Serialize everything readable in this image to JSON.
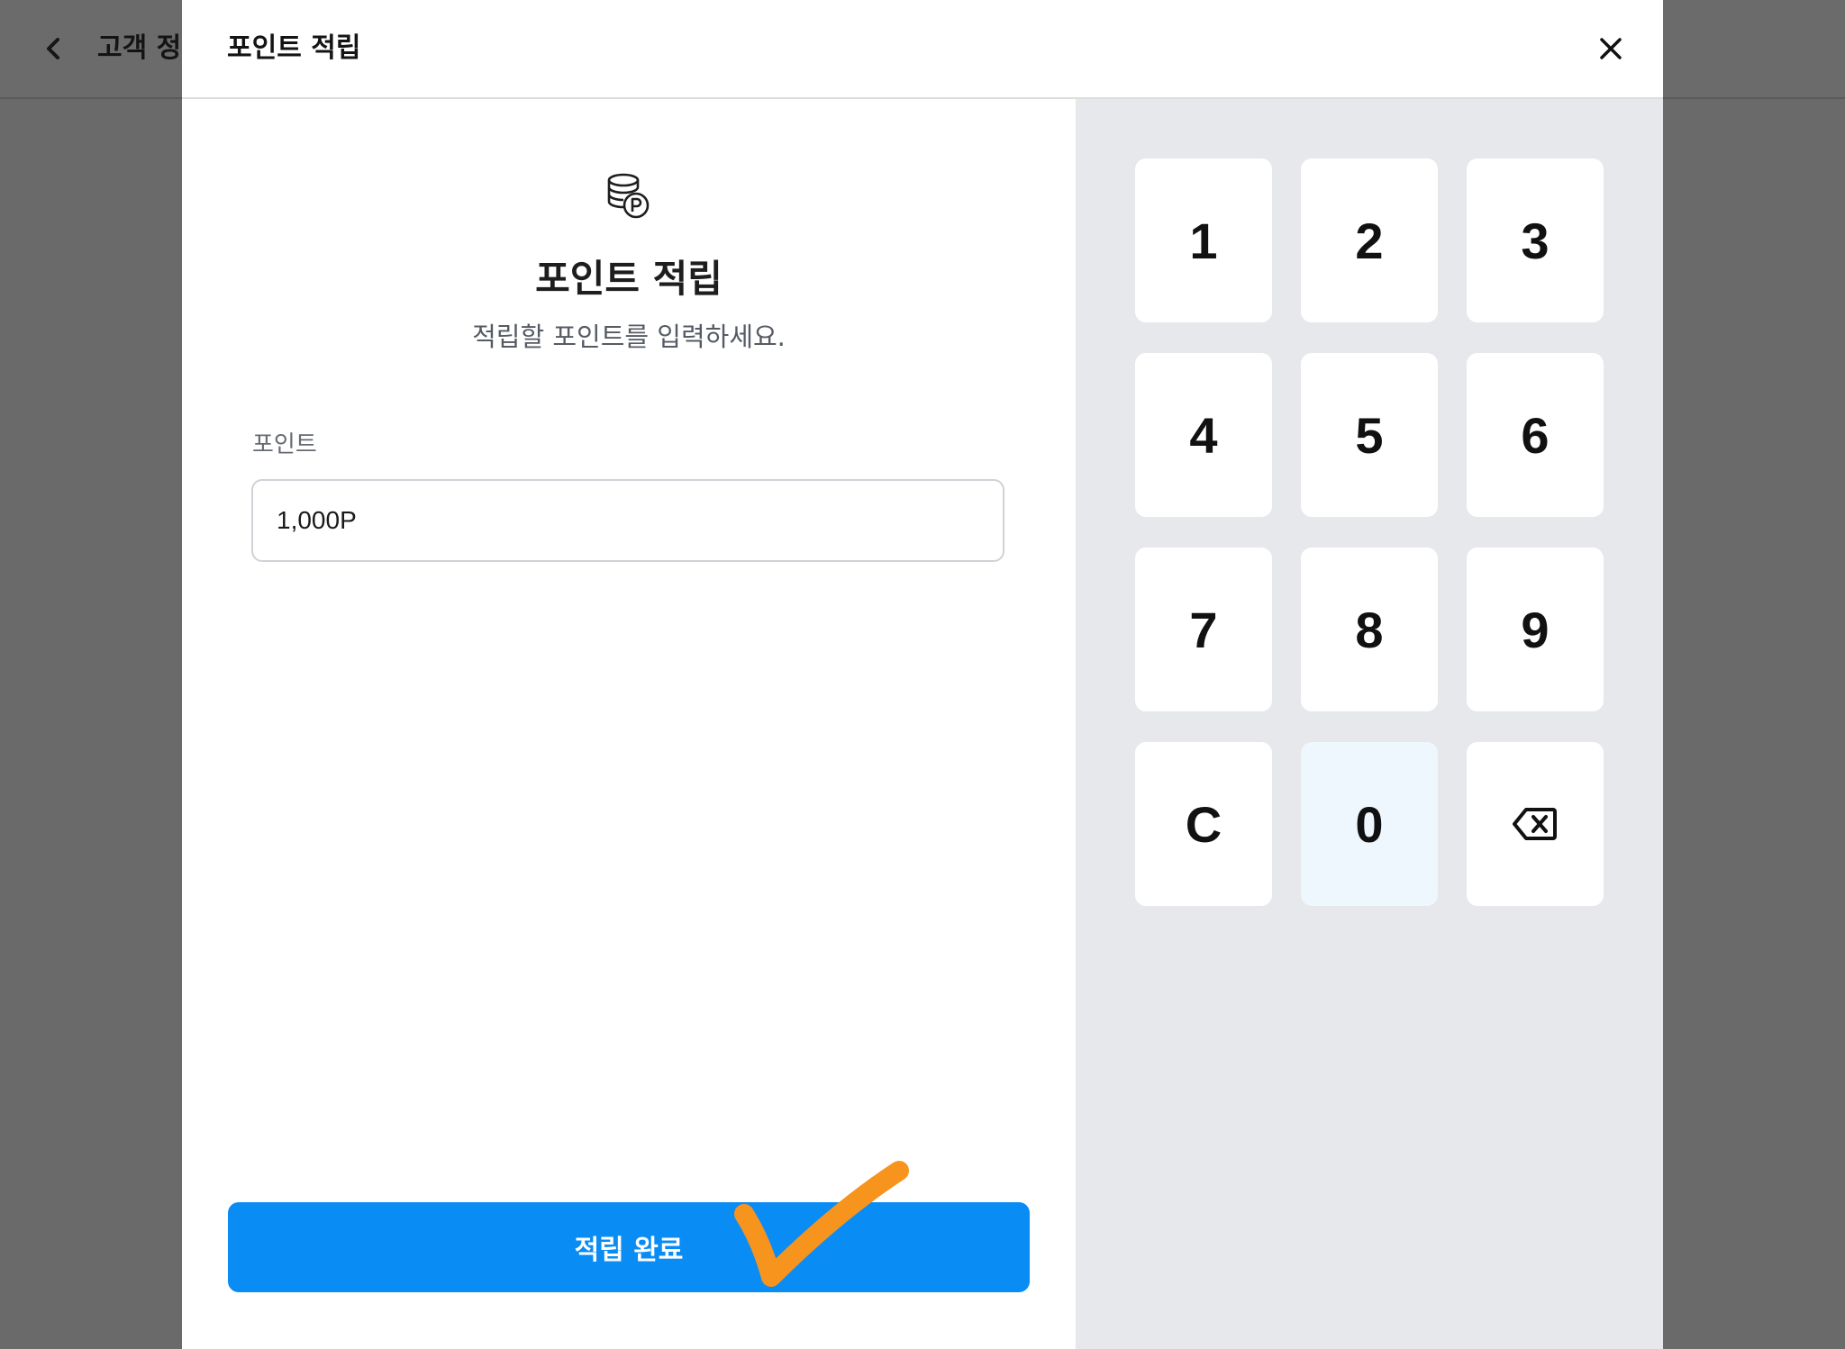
{
  "background": {
    "title": "고객 정",
    "back_icon": "chevron-left-icon"
  },
  "modal": {
    "title": "포인트 적립",
    "close_icon": "close-icon"
  },
  "form": {
    "icon": "coins-point-icon",
    "heading": "포인트 적립",
    "subtitle": "적립할 포인트를 입력하세요.",
    "field_label": "포인트",
    "field_value": "1,000P",
    "submit_label": "적립 완료"
  },
  "keypad": {
    "keys": [
      {
        "label": "1"
      },
      {
        "label": "2"
      },
      {
        "label": "3"
      },
      {
        "label": "4"
      },
      {
        "label": "5"
      },
      {
        "label": "6"
      },
      {
        "label": "7"
      },
      {
        "label": "8"
      },
      {
        "label": "9"
      },
      {
        "label": "C"
      },
      {
        "label": "0",
        "active": true
      },
      {
        "label": "",
        "icon": "backspace-icon"
      }
    ]
  },
  "colors": {
    "accent": "#0a8cf5",
    "overlay": "#6a6a6a",
    "keypad_bg": "#e6e8eb",
    "annotation_check": "#f7941d"
  }
}
